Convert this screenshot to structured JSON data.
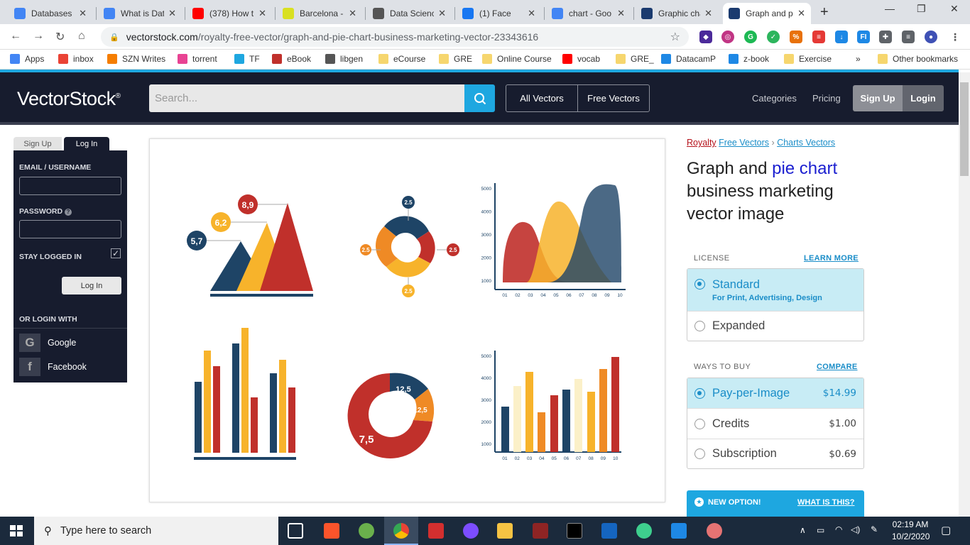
{
  "browser": {
    "tabs": [
      {
        "title": "Databases a",
        "favicon": "link-icon",
        "color": "#4285f4"
      },
      {
        "title": "What is Dat",
        "favicon": "link-icon",
        "color": "#4285f4"
      },
      {
        "title": "(378) How t",
        "favicon": "youtube-icon",
        "color": "#ff0000"
      },
      {
        "title": "Barcelona -",
        "favicon": "zeta-icon",
        "color": "#d9e021"
      },
      {
        "title": "Data Scienc",
        "favicon": "globe-icon",
        "color": "#555555"
      },
      {
        "title": "(1) Face",
        "favicon": "facebook-icon",
        "color": "#1877f2"
      },
      {
        "title": "chart - Goo",
        "favicon": "google-icon",
        "color": "#4285f4"
      },
      {
        "title": "Graphic cha",
        "favicon": "vectorstock-icon",
        "color": "#1b3b6f"
      },
      {
        "title": "Graph and p",
        "favicon": "vectorstock-icon",
        "color": "#1b3b6f"
      }
    ],
    "url_host": "vectorstock.com",
    "url_path": "/royalty-free-vector/graph-and-pie-chart-business-marketing-vector-23343616",
    "bookmarks": [
      {
        "label": "Apps",
        "icon": "apps-grid-icon"
      },
      {
        "label": "inbox",
        "icon": "gmail-icon"
      },
      {
        "label": "SZN Writes",
        "icon": "blogger-icon"
      },
      {
        "label": "torrent",
        "icon": "tf-icon"
      },
      {
        "label": "TF",
        "icon": "u-icon"
      },
      {
        "label": "eBook",
        "icon": "pd-icon"
      },
      {
        "label": "libgen",
        "icon": "libgen-icon"
      },
      {
        "label": "eCourse",
        "icon": "folder-icon"
      },
      {
        "label": "GRE",
        "icon": "folder-icon"
      },
      {
        "label": "Online Course",
        "icon": "folder-icon"
      },
      {
        "label": "vocab",
        "icon": "youtube-icon"
      },
      {
        "label": "GRE_",
        "icon": "folder-icon"
      },
      {
        "label": "DatacamP",
        "icon": "shield-icon"
      },
      {
        "label": "z-book",
        "icon": "globe-icon"
      },
      {
        "label": "Exercise",
        "icon": "folder-icon"
      }
    ],
    "more_bookmarks": "»",
    "other_bookmarks": "Other bookmarks"
  },
  "site": {
    "logo": "VectorStock",
    "logo_mark": "®",
    "search_placeholder": "Search...",
    "nav_all": "All Vectors",
    "nav_free": "Free Vectors",
    "nav_categories": "Categories",
    "nav_pricing": "Pricing",
    "signup": "Sign Up",
    "login": "Login"
  },
  "login_panel": {
    "tab_signup": "Sign Up",
    "tab_login": "Log In",
    "email_label": "EMAIL / USERNAME",
    "password_label": "PASSWORD",
    "stay_label": "STAY LOGGED IN",
    "login_button": "Log In",
    "or_login": "OR LOGIN WITH",
    "google": "Google",
    "facebook": "Facebook"
  },
  "product": {
    "crumb_royalty": "Royalty",
    "crumb_free": "Free Vectors",
    "crumb_sep": "›",
    "crumb_charts": "Charts Vectors",
    "title_pre": "Graph and",
    "title_highlight": "pie chart",
    "title_post": "business marketing vector image",
    "license_head": "LICENSE",
    "learn_more": "LEARN MORE",
    "license_options": [
      {
        "label": "Standard",
        "sub": "For Print, Advertising, Design"
      },
      {
        "label": "Expanded"
      }
    ],
    "ways_head": "WAYS TO BUY",
    "compare": "COMPARE",
    "buy_options": [
      {
        "label": "Pay-per-Image",
        "price": "$14.99"
      },
      {
        "label": "Credits",
        "price": "$1.00"
      },
      {
        "label": "Subscription",
        "price": "$0.69"
      }
    ],
    "new_option": "NEW OPTION!",
    "what_is_this": "WHAT IS THIS?"
  },
  "illustration": {
    "triangle_labels": [
      "5,7",
      "6,2",
      "8,9"
    ],
    "ring_labels": [
      "2.5",
      "2.5",
      "2.5",
      "2.5"
    ],
    "area_y_ticks": [
      "5000",
      "4000",
      "3000",
      "2000",
      "1000"
    ],
    "area_x_ticks": [
      "01",
      "02",
      "03",
      "04",
      "05",
      "06",
      "07",
      "08",
      "09",
      "10"
    ],
    "donut_labels": [
      "12,5",
      "12,5",
      "7,5"
    ],
    "bar_y_ticks": [
      "5000",
      "4000",
      "3000",
      "2000",
      "1000"
    ],
    "bar_x_ticks": [
      "01",
      "02",
      "03",
      "04",
      "05",
      "06",
      "07",
      "08",
      "09",
      "10"
    ],
    "colors": {
      "navy": "#1e4466",
      "yellow": "#f7b32b",
      "red": "#c0302b",
      "orange": "#ef8a25",
      "cream": "#fbf0c8"
    }
  },
  "taskbar": {
    "search_placeholder": "Type here to search",
    "time": "02:19 AM",
    "date": "10/2/2020"
  }
}
